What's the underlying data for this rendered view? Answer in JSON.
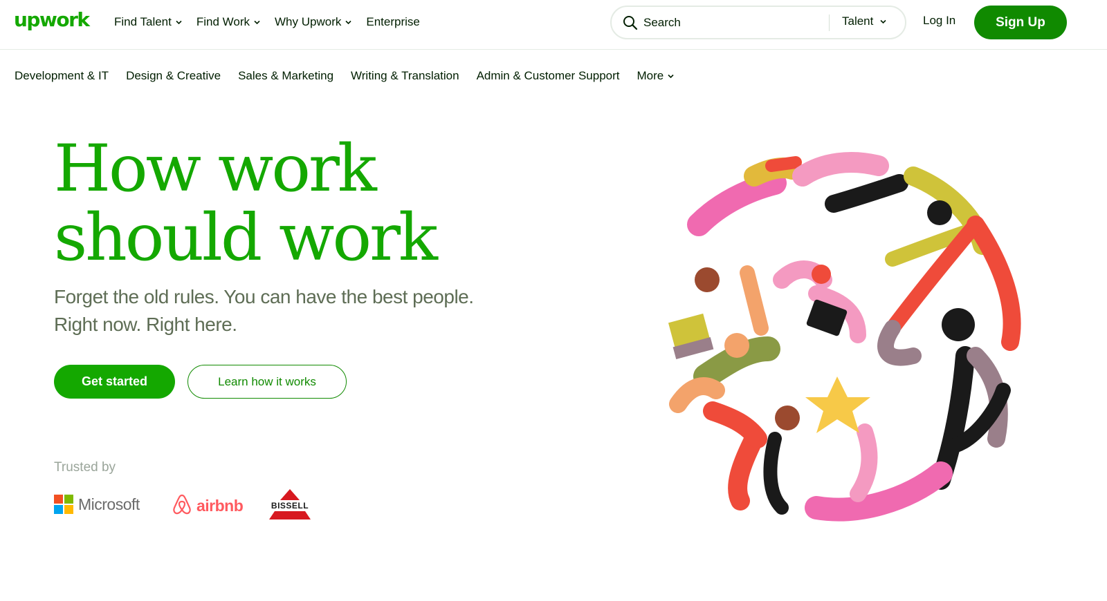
{
  "header": {
    "logo": "upwork",
    "nav": [
      {
        "label": "Find Talent",
        "has_dropdown": true
      },
      {
        "label": "Find Work",
        "has_dropdown": true
      },
      {
        "label": "Why Upwork",
        "has_dropdown": true
      },
      {
        "label": "Enterprise",
        "has_dropdown": false
      }
    ],
    "search": {
      "placeholder": "Search",
      "scope": "Talent",
      "icon": "search-icon"
    },
    "login_label": "Log In",
    "signup_label": "Sign Up"
  },
  "categories": [
    {
      "label": "Development & IT"
    },
    {
      "label": "Design & Creative"
    },
    {
      "label": "Sales & Marketing"
    },
    {
      "label": "Writing & Translation"
    },
    {
      "label": "Admin & Customer Support"
    },
    {
      "label": "More",
      "has_dropdown": true
    }
  ],
  "hero": {
    "headline_line1": "How work",
    "headline_line2": "should work",
    "subtext_line1": "Forget the old rules. You can have the best people.",
    "subtext_line2": "Right now. Right here.",
    "primary_cta": "Get started",
    "secondary_cta": "Learn how it works"
  },
  "trusted": {
    "label": "Trusted by",
    "logos": [
      {
        "name": "Microsoft",
        "text": "Microsoft"
      },
      {
        "name": "airbnb",
        "text": "airbnb"
      },
      {
        "name": "Bissell",
        "text": "BISSELL"
      }
    ]
  },
  "colors": {
    "brand_green": "#14a800",
    "dark_green": "#108a00",
    "text": "#001e00",
    "subtext": "#5e6d55",
    "muted": "#9aa59a",
    "airbnb_red": "#ff5a5f"
  }
}
